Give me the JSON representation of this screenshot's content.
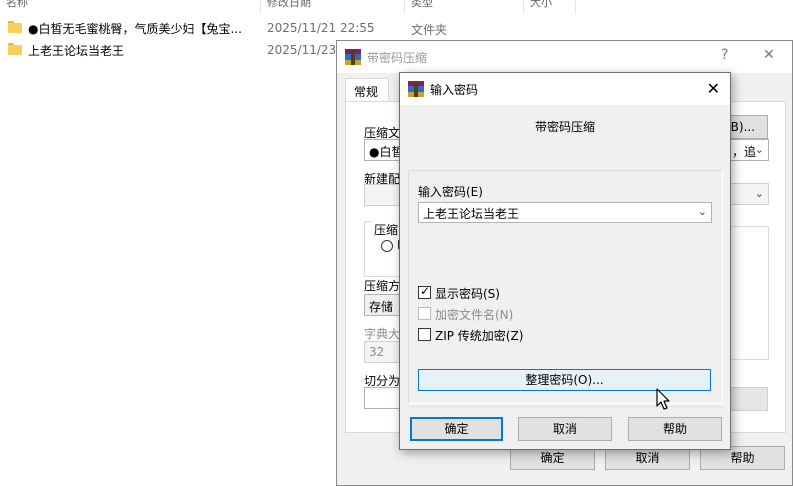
{
  "explorer": {
    "columns": {
      "name": "名称",
      "date": "修改日期",
      "type": "类型",
      "size": "大小"
    },
    "files": [
      {
        "name": "●白皙无毛蜜桃臀，气质美少妇【兔宝...",
        "date": "2025/11/21 22:55",
        "type": "文件夹"
      },
      {
        "name": "上老王论坛当老王",
        "date": "2025/11/23",
        "type": ""
      }
    ]
  },
  "compress_dialog": {
    "title": "带密码压缩",
    "help_glyph": "?",
    "close_glyph": "✕",
    "tab_general": "常规",
    "archive_name_label": "压缩文",
    "archive_name_value": "●白皙",
    "browse_button": "(B)...",
    "update_mode_value": "，追",
    "new_profile_label": "新建配",
    "archive_format_label": "压缩",
    "format_radio_partial": "R",
    "method_label": "压缩方",
    "method_value": "存储",
    "dict_label": "字典大",
    "dict_value": "32",
    "split_label": "切分为",
    "ok": "确定",
    "cancel": "取消",
    "help": "帮助"
  },
  "password_dialog": {
    "title": "输入密码",
    "close_glyph": "✕",
    "heading": "带密码压缩",
    "password_label": "输入密码(E)",
    "password_value": "上老王论坛当老王",
    "show_password": {
      "label": "显示密码(S)",
      "checked": true
    },
    "encrypt_names": {
      "label": "加密文件名(N)",
      "checked": false,
      "disabled": true
    },
    "zip_legacy": {
      "label": "ZIP 传统加密(Z)",
      "checked": false
    },
    "organize_button": "整理密码(O)...",
    "ok": "确定",
    "cancel": "取消",
    "help": "帮助"
  },
  "colors": {
    "accent": "#0078d7",
    "folder": "#f7cf5a"
  }
}
